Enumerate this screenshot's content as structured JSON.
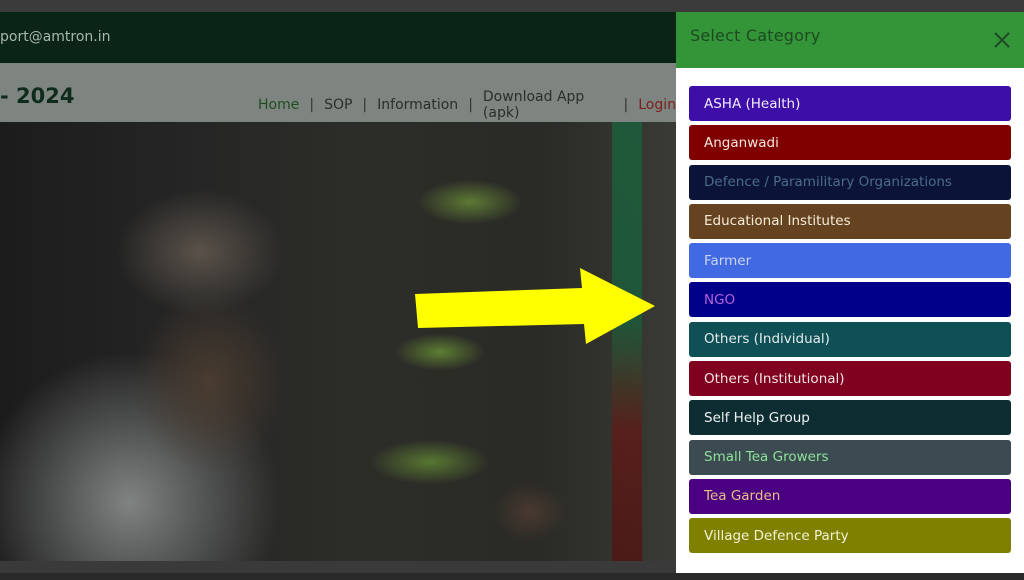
{
  "page": {
    "support_email": "port@amtron.in",
    "brand_year": "- 2024",
    "nav": {
      "home": "Home",
      "sop": "SOP",
      "information": "Information",
      "download": "Download App (apk)",
      "login": "Login",
      "separator": "|"
    }
  },
  "modal": {
    "title": "Select Category",
    "close_icon": "close-icon",
    "header_color": "#339438",
    "categories": [
      {
        "label": "ASHA (Health)",
        "bg": "#3d0ea8",
        "fg": "#f2ecff"
      },
      {
        "label": "Anganwadi",
        "bg": "#800000",
        "fg": "#f4e7e2"
      },
      {
        "label": "Defence / Paramilitary Organizations",
        "bg": "#0c1338",
        "fg": "#4a6b8c"
      },
      {
        "label": "Educational Institutes",
        "bg": "#654321",
        "fg": "#f5ecd8"
      },
      {
        "label": "Farmer",
        "bg": "#4169e1",
        "fg": "#c9d4f0"
      },
      {
        "label": "NGO",
        "bg": "#00008b",
        "fg": "#b464d8"
      },
      {
        "label": "Others (Individual)",
        "bg": "#0f4f56",
        "fg": "#e3ecec"
      },
      {
        "label": "Others (Institutional)",
        "bg": "#800020",
        "fg": "#f3e4e6"
      },
      {
        "label": "Self Help Group",
        "bg": "#0d2d33",
        "fg": "#eef3f3"
      },
      {
        "label": "Small Tea Growers",
        "bg": "#3c4a52",
        "fg": "#8ee29a"
      },
      {
        "label": "Tea Garden",
        "bg": "#4b0082",
        "fg": "#e8c08a"
      },
      {
        "label": "Village Defence Party",
        "bg": "#808000",
        "fg": "#f4f2d4"
      }
    ]
  },
  "annotation": {
    "arrow_color": "#ffff00"
  }
}
